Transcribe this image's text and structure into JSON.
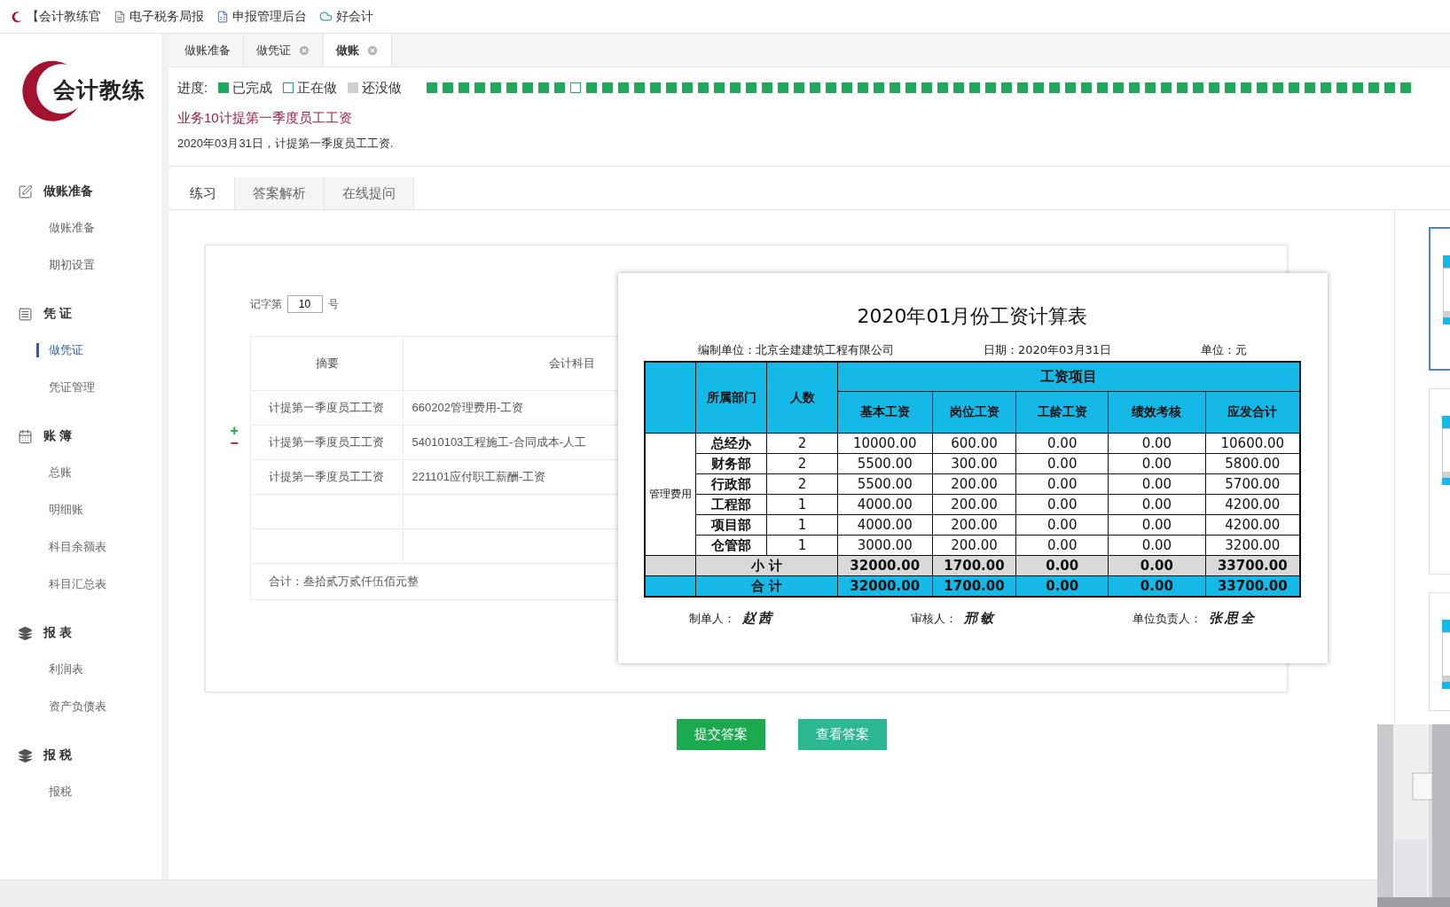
{
  "bookmarks": [
    {
      "kind": "logo",
      "label": "【会计教练官"
    },
    {
      "kind": "document",
      "label": "电子税务局报"
    },
    {
      "kind": "sheet",
      "label": "申报管理后台"
    },
    {
      "kind": "cloud",
      "label": "好会计"
    }
  ],
  "tabs": [
    {
      "label": "做账准备",
      "selected": false,
      "closable": false
    },
    {
      "label": "做凭证",
      "selected": false,
      "closable": true
    },
    {
      "label": "做账",
      "selected": true,
      "closable": true
    }
  ],
  "logo": {
    "text": "会计教练"
  },
  "sidebar": {
    "groups": [
      {
        "title": "做账准备",
        "items": [
          {
            "label": "做账准备",
            "selected": false
          },
          {
            "label": "期初设置",
            "selected": false
          }
        ]
      },
      {
        "title": "凭 证",
        "items": [
          {
            "label": "做凭证",
            "selected": true
          },
          {
            "label": "凭证管理",
            "selected": false
          }
        ]
      },
      {
        "title": "账 簿",
        "items": [
          {
            "label": "总账",
            "selected": false
          },
          {
            "label": "明细账",
            "selected": false
          },
          {
            "label": "科目余额表",
            "selected": false
          },
          {
            "label": "科目汇总表",
            "selected": false
          }
        ]
      },
      {
        "title": "报 表",
        "items": [
          {
            "label": "利润表",
            "selected": false
          },
          {
            "label": "资产负债表",
            "selected": false
          }
        ]
      },
      {
        "title": "报 税",
        "items": [
          {
            "label": "报税",
            "selected": false
          }
        ]
      }
    ]
  },
  "progress": {
    "label": "进度:",
    "legend": [
      {
        "label": "已完成",
        "kind": "done"
      },
      {
        "label": "正在做",
        "kind": "doing"
      },
      {
        "label": "还没做",
        "kind": "todo"
      }
    ],
    "steps": [
      {
        "done": true,
        "selected": false
      },
      {
        "done": true,
        "selected": false
      },
      {
        "done": true,
        "selected": false
      },
      {
        "done": true,
        "selected": false
      },
      {
        "done": true,
        "selected": false
      },
      {
        "done": true,
        "selected": false
      },
      {
        "done": true,
        "selected": false
      },
      {
        "done": true,
        "selected": false
      },
      {
        "done": true,
        "selected": false
      },
      {
        "done": false,
        "selected": true
      },
      {
        "done": true,
        "selected": false
      },
      {
        "done": true,
        "selected": false
      },
      {
        "done": true,
        "selected": false
      },
      {
        "done": true,
        "selected": false
      },
      {
        "done": true,
        "selected": false
      },
      {
        "done": true,
        "selected": false
      },
      {
        "done": true,
        "selected": false
      },
      {
        "done": true,
        "selected": false
      },
      {
        "done": true,
        "selected": false
      },
      {
        "done": true,
        "selected": false
      },
      {
        "done": true,
        "selected": false
      },
      {
        "done": true,
        "selected": false
      },
      {
        "done": true,
        "selected": false
      },
      {
        "done": true,
        "selected": false
      },
      {
        "done": true,
        "selected": false
      },
      {
        "done": true,
        "selected": false
      },
      {
        "done": true,
        "selected": false
      },
      {
        "done": true,
        "selected": false
      },
      {
        "done": true,
        "selected": false
      },
      {
        "done": true,
        "selected": false
      },
      {
        "done": true,
        "selected": false
      },
      {
        "done": true,
        "selected": false
      },
      {
        "done": true,
        "selected": false
      },
      {
        "done": true,
        "selected": false
      },
      {
        "done": true,
        "selected": false
      },
      {
        "done": true,
        "selected": false
      },
      {
        "done": true,
        "selected": false
      },
      {
        "done": true,
        "selected": false
      },
      {
        "done": true,
        "selected": false
      },
      {
        "done": true,
        "selected": false
      },
      {
        "done": true,
        "selected": false
      },
      {
        "done": true,
        "selected": false
      },
      {
        "done": true,
        "selected": false
      },
      {
        "done": true,
        "selected": false
      },
      {
        "done": true,
        "selected": false
      },
      {
        "done": true,
        "selected": false
      },
      {
        "done": true,
        "selected": false
      },
      {
        "done": true,
        "selected": false
      },
      {
        "done": true,
        "selected": false
      },
      {
        "done": true,
        "selected": false
      },
      {
        "done": true,
        "selected": false
      },
      {
        "done": true,
        "selected": false
      },
      {
        "done": true,
        "selected": false
      },
      {
        "done": true,
        "selected": false
      },
      {
        "done": true,
        "selected": false
      },
      {
        "done": true,
        "selected": false
      },
      {
        "done": true,
        "selected": false
      },
      {
        "done": true,
        "selected": false
      },
      {
        "done": true,
        "selected": false
      },
      {
        "done": true,
        "selected": false
      },
      {
        "done": true,
        "selected": false
      },
      {
        "done": true,
        "selected": false
      }
    ]
  },
  "task": {
    "title": "业务10计提第一季度员工工资",
    "description": "2020年03月31日，计提第一季度员工工资."
  },
  "subtabs": [
    {
      "label": "练习",
      "selected": true
    },
    {
      "label": "答案解析",
      "selected": false
    },
    {
      "label": "在线提问",
      "selected": false
    }
  ],
  "voucher": {
    "prefix": "记字第",
    "number": "10",
    "suffix": "号",
    "columns": [
      "摘要",
      "会计科目"
    ],
    "row_controls": [
      "+",
      "−"
    ],
    "rows": [
      {
        "summary": "计提第一季度员工工资",
        "account": "660202管理费用-工资"
      },
      {
        "summary": "计提第一季度员工工资",
        "account": "54010103工程施工-合同成本-人工"
      },
      {
        "summary": "计提第一季度员工工资",
        "account": "221101应付职工薪酬-工资"
      },
      {},
      {}
    ],
    "total": "合计：叁拾贰万贰仟伍佰元整"
  },
  "salary_sheet": {
    "title": "2020年01月份工资计算表",
    "meta": [
      "编制单位：北京全建建筑工程有限公司",
      "日期：2020年03月31日",
      "单位：元"
    ],
    "group_header": "工资项目",
    "dept_header": "所属部门",
    "count_header": "人数",
    "columns": [
      "基本工资",
      "岗位工资",
      "工龄工资",
      "绩效考核",
      "应发合计"
    ],
    "group_label": "管理费用",
    "rows": [
      {
        "dept": "总经办",
        "count": "2",
        "values": [
          "10000.00",
          "600.00",
          "0.00",
          "0.00",
          "10600.00"
        ]
      },
      {
        "dept": "财务部",
        "count": "2",
        "values": [
          "5500.00",
          "300.00",
          "0.00",
          "0.00",
          "5800.00"
        ]
      },
      {
        "dept": "行政部",
        "count": "2",
        "values": [
          "5500.00",
          "200.00",
          "0.00",
          "0.00",
          "5700.00"
        ]
      },
      {
        "dept": "工程部",
        "count": "1",
        "values": [
          "4000.00",
          "200.00",
          "0.00",
          "0.00",
          "4200.00"
        ]
      },
      {
        "dept": "项目部",
        "count": "1",
        "values": [
          "4000.00",
          "200.00",
          "0.00",
          "0.00",
          "4200.00"
        ]
      },
      {
        "dept": "仓管部",
        "count": "1",
        "values": [
          "3000.00",
          "200.00",
          "0.00",
          "0.00",
          "3200.00"
        ]
      }
    ],
    "totals": [
      {
        "kind": "subtotal",
        "label": "小 计",
        "values": [
          "32000.00",
          "1700.00",
          "0.00",
          "0.00",
          "33700.00"
        ]
      },
      {
        "kind": "total",
        "label": "合 计",
        "values": [
          "32000.00",
          "1700.00",
          "0.00",
          "0.00",
          "33700.00"
        ]
      }
    ],
    "signers": [
      {
        "role": "制单人：",
        "name": "赵茜"
      },
      {
        "role": "审核人：",
        "name": "邢敏"
      },
      {
        "role": "单位负责人：",
        "name": "张思全"
      }
    ]
  },
  "actions": [
    {
      "label": "提交答案",
      "kind": "submit"
    },
    {
      "label": "查看答案",
      "kind": "view"
    }
  ],
  "thumbnails": [
    {
      "selected": true
    },
    {
      "selected": false
    },
    {
      "selected": false
    }
  ]
}
